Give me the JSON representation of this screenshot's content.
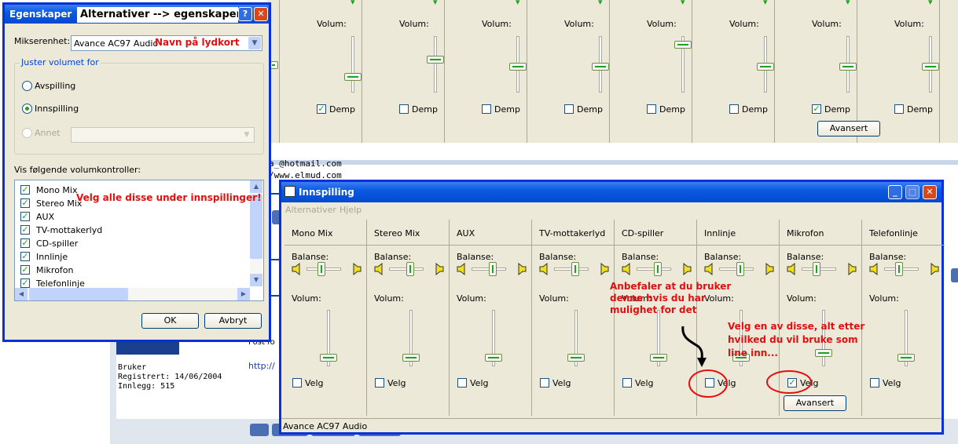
{
  "top_mixer": {
    "columns": [
      {
        "volume_label": "Volum:",
        "mute_label": "Demp",
        "muted": true,
        "level": 0.25
      },
      {
        "volume_label": "Volum:",
        "mute_label": "Demp",
        "muted": false,
        "level": 0.6
      },
      {
        "volume_label": "Volum:",
        "mute_label": "Demp",
        "muted": false,
        "level": 0.45
      },
      {
        "volume_label": "Volum:",
        "mute_label": "Demp",
        "muted": false,
        "level": 0.45
      },
      {
        "volume_label": "Volum:",
        "mute_label": "Demp",
        "muted": false,
        "level": 0.9
      },
      {
        "volume_label": "Volum:",
        "mute_label": "Demp",
        "muted": false,
        "level": 0.45
      },
      {
        "volume_label": "Volum:",
        "mute_label": "Demp",
        "muted": true,
        "level": 0.45,
        "advanced_label": "Avansert"
      },
      {
        "volume_label": "Volum:",
        "mute_label": "Demp",
        "muted": false,
        "level": 0.45
      }
    ]
  },
  "background_page": {
    "email_line": "a_@hotmail.com",
    "url_line": "/www.elmud.com",
    "user_role": "Bruker",
    "registered": "Registrert: 14/06/2004",
    "posts": "Innlegg: 515",
    "post_snippet": "Post fo",
    "link_snippet": "http://"
  },
  "properties_dialog": {
    "title": "Egenskaper",
    "title_annotation": "Alternativer --> egenskaper",
    "mixer_device_label": "Mikserenhet:",
    "mixer_device_value": "Avance AC97 Audio",
    "mixer_device_annotation": "Navn på lydkort",
    "adjust_group_label": "Juster volumet for",
    "radio_options": [
      {
        "label": "Avspilling",
        "selected": false,
        "enabled": true
      },
      {
        "label": "Innspilling",
        "selected": true,
        "enabled": true
      },
      {
        "label": "Annet",
        "selected": false,
        "enabled": false
      }
    ],
    "controls_label": "Vis følgende volumkontroller:",
    "controls": [
      {
        "label": "Mono Mix",
        "checked": true
      },
      {
        "label": "Stereo Mix",
        "checked": true
      },
      {
        "label": "AUX",
        "checked": true
      },
      {
        "label": "TV-mottakerlyd",
        "checked": true
      },
      {
        "label": "CD-spiller",
        "checked": true
      },
      {
        "label": "Innlinje",
        "checked": true
      },
      {
        "label": "Mikrofon",
        "checked": true
      },
      {
        "label": "Telefonlinje",
        "checked": true
      }
    ],
    "controls_annotation": "Velg alle disse under innspillinger!",
    "ok_label": "OK",
    "cancel_label": "Avbryt"
  },
  "recording_window": {
    "title": "Innspilling",
    "menu": [
      "Alternativer",
      "Hjelp"
    ],
    "balance_label": "Balanse:",
    "volume_label": "Volum:",
    "select_label": "Velg",
    "channels": [
      {
        "name": "Mono Mix",
        "selected": false,
        "level": 0.1,
        "balance": 0.5
      },
      {
        "name": "Stereo Mix",
        "selected": false,
        "level": 0.1,
        "balance": 0.7
      },
      {
        "name": "AUX",
        "selected": false,
        "level": 0.1,
        "balance": 0.7
      },
      {
        "name": "TV-mottakerlyd",
        "selected": false,
        "level": 0.1,
        "balance": 0.7
      },
      {
        "name": "CD-spiller",
        "selected": false,
        "level": 0.1,
        "balance": 0.7
      },
      {
        "name": "Innlinje",
        "selected": false,
        "level": 0.1,
        "balance": 0.7
      },
      {
        "name": "Mikrofon",
        "selected": true,
        "level": 0.2,
        "balance": 0.5
      },
      {
        "name": "Telefonlinje",
        "selected": false,
        "level": 0.1,
        "balance": 0.5
      }
    ],
    "advanced_label": "Avansert",
    "status_text": "Avance AC97 Audio",
    "annotation_recommend": "Anbefaler at du bruker denne hvis du har mulighet for det",
    "annotation_choose": "Velg en av disse, alt etter hvilked du vil bruke som line inn..."
  },
  "colors": {
    "annotation": "#e01010",
    "xp_blue": "#0a5ae0",
    "face": "#ece9d8"
  }
}
